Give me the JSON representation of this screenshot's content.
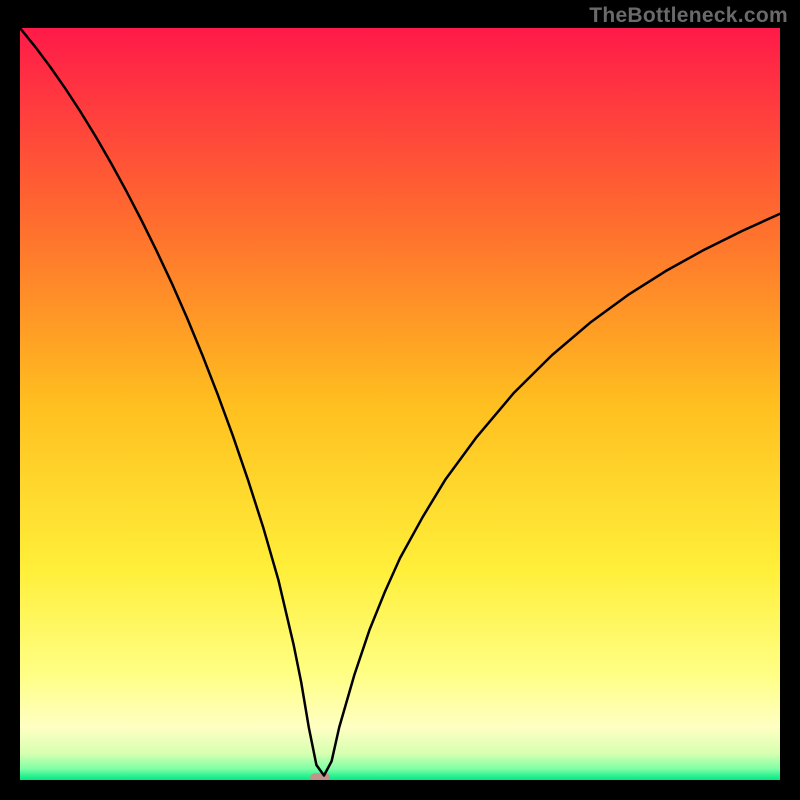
{
  "branding": {
    "watermark": "TheBottleneck.com"
  },
  "chart_data": {
    "type": "line",
    "title": "",
    "xlabel": "",
    "ylabel": "",
    "xlim": [
      0,
      100
    ],
    "ylim": [
      0,
      100
    ],
    "grid": false,
    "legend": false,
    "background": {
      "fill": "vertical-gradient",
      "stops": [
        {
          "pos": 0.0,
          "color": "#ff1a49"
        },
        {
          "pos": 0.25,
          "color": "#ff6a2f"
        },
        {
          "pos": 0.5,
          "color": "#ffbf1f"
        },
        {
          "pos": 0.72,
          "color": "#ffef3a"
        },
        {
          "pos": 0.86,
          "color": "#ffff85"
        },
        {
          "pos": 0.93,
          "color": "#ffffc3"
        },
        {
          "pos": 0.965,
          "color": "#d6ffb0"
        },
        {
          "pos": 0.985,
          "color": "#7fffa6"
        },
        {
          "pos": 1.0,
          "color": "#00e884"
        }
      ]
    },
    "series": [
      {
        "name": "bottleneck-curve",
        "stroke": "#000000",
        "stroke_width": 2.5,
        "x": [
          0,
          2,
          4,
          6,
          8,
          10,
          12,
          14,
          16,
          18,
          20,
          22,
          24,
          26,
          28,
          30,
          32,
          34,
          36,
          37,
          38,
          39,
          40,
          41,
          42,
          44,
          46,
          48,
          50,
          53,
          56,
          60,
          65,
          70,
          75,
          80,
          85,
          90,
          95,
          100
        ],
        "values": [
          100,
          97.5,
          94.8,
          91.9,
          88.8,
          85.5,
          82.0,
          78.3,
          74.4,
          70.3,
          66.0,
          61.4,
          56.5,
          51.3,
          45.8,
          39.9,
          33.6,
          26.6,
          18.0,
          13.0,
          7.0,
          2.0,
          0.6,
          2.5,
          7.0,
          14.0,
          20.0,
          25.0,
          29.5,
          35.0,
          40.0,
          45.5,
          51.5,
          56.5,
          60.8,
          64.5,
          67.7,
          70.5,
          73.0,
          75.3
        ]
      }
    ],
    "markers": [
      {
        "name": "target-pill",
        "shape": "rounded-rect",
        "x": 39.5,
        "y": 0.3,
        "w": 2.6,
        "h": 1.2,
        "fill": "#d28a8a",
        "fill_opacity": 0.9
      }
    ]
  }
}
